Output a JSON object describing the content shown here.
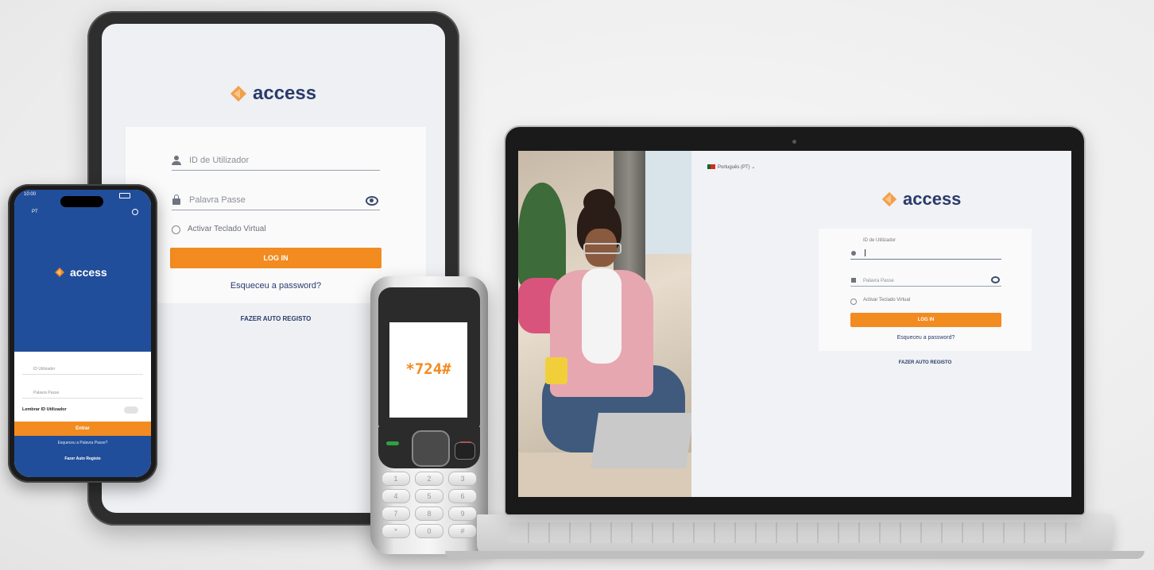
{
  "brand": {
    "name": "access",
    "accent_color": "#f28b20",
    "navy_color": "#2a3b6b",
    "phone_blue": "#214e9a"
  },
  "tablet": {
    "user_id_placeholder": "ID de Utilizador",
    "password_placeholder": "Palavra Passe",
    "virtual_keyboard_label": "Activar Teclado Virtual",
    "login_button": "LOG IN",
    "forgot_password": "Esqueceu a password?",
    "self_register": "FAZER AUTO REGISTO"
  },
  "smartphone": {
    "time": "10:00",
    "language": "PT",
    "user_id_placeholder": "ID Utilizador",
    "password_placeholder": "Palavra Passe",
    "remember_label": "Lembrar ID Utilizador",
    "login_button": "Entrar",
    "forgot_password": "Esqueceu a Palavra Passe?",
    "self_register": "Fazer Auto Registo"
  },
  "feature_phone": {
    "ussd_code": "*724#",
    "keys": [
      "1",
      "2",
      "3",
      "4",
      "5",
      "6",
      "7",
      "8",
      "9",
      "*",
      "0",
      "#"
    ]
  },
  "laptop": {
    "language_selector": "Português (PT)",
    "user_id_label": "ID de Utilizador",
    "password_placeholder": "Palavra Passe",
    "virtual_keyboard_label": "Activar Teclado Virtual",
    "login_button": "LOG IN",
    "forgot_password": "Esqueceu a password?",
    "self_register": "FAZER AUTO REGISTO"
  }
}
